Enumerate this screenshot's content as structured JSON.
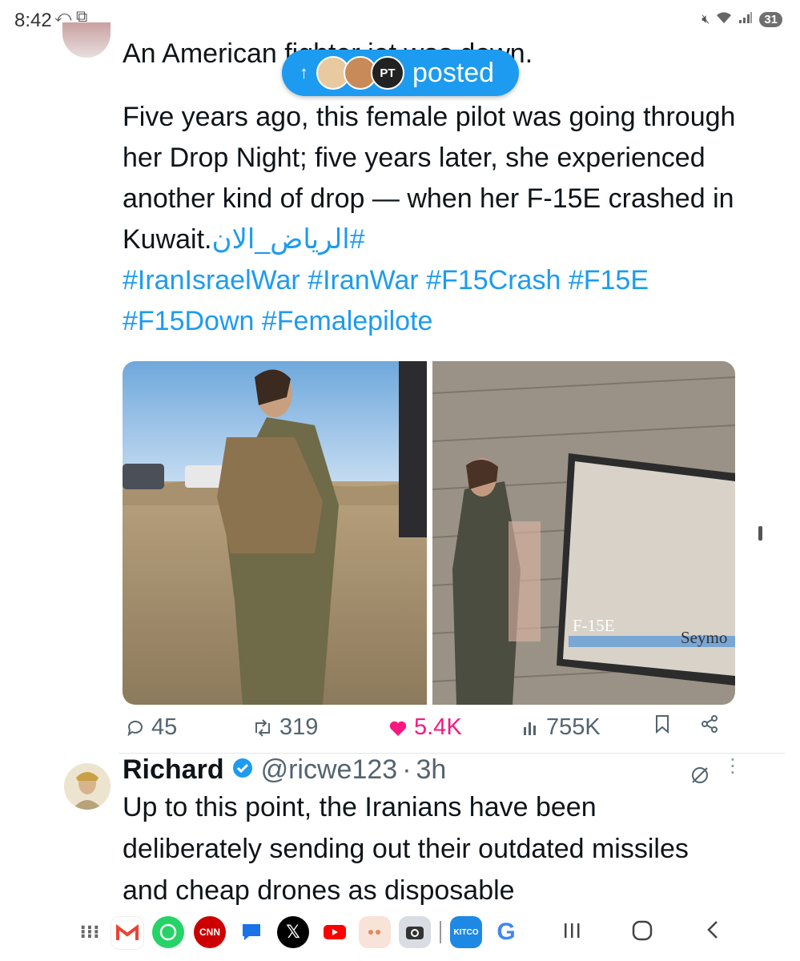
{
  "status": {
    "time": "8:42",
    "battery": "31"
  },
  "tweet": {
    "line_first": "An American fighter jet was down.",
    "para2": "Five years ago, this female pilot was going through her Drop Night; five years later, she experienced another kind of drop — when her F-15E crashed in Kuwait.",
    "hashtag_arabic": "#الرياض_الان",
    "hashtags": [
      "#IranIsraelWar",
      "#IranWar",
      "#F15Crash",
      "#F15E",
      "#F15Down",
      "#Femalepilote"
    ],
    "images": [
      {
        "alt": "female pilot in flight gear in the desert"
      },
      {
        "alt": "female pilot in front of projection screen",
        "screen_text_left": "F-15E",
        "screen_text_right": "Seymo"
      }
    ],
    "stats": {
      "replies": "45",
      "reposts": "319",
      "likes": "5.4K",
      "views": "755K"
    }
  },
  "posted_pill": {
    "label": "posted",
    "face3": "PT"
  },
  "reply": {
    "name": "Richard",
    "handle": "@ricwe123",
    "time": "3h",
    "text": "Up to this point, the Iranians have been deliberately sending out their outdated missiles and cheap drones as disposable"
  },
  "dock": {
    "apps": [
      "apps-grid",
      "Gmail",
      "WhatsApp",
      "CNN",
      "Messages",
      "X",
      "YouTube",
      "Notes",
      "Camera",
      "KITCO",
      "Google"
    ],
    "cnn_label": "CNN",
    "kitco_label": "KITCO"
  },
  "colors": {
    "accent": "#1d9bf0",
    "like": "#f91880",
    "muted": "#536471"
  }
}
